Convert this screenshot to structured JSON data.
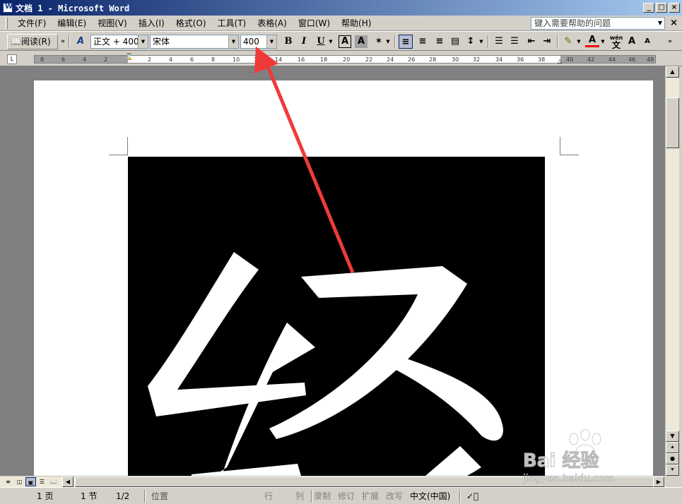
{
  "window": {
    "title": "文档 1 - Microsoft Word"
  },
  "menu": {
    "items": [
      "文件(F)",
      "编辑(E)",
      "视图(V)",
      "插入(I)",
      "格式(O)",
      "工具(T)",
      "表格(A)",
      "窗口(W)",
      "帮助(H)"
    ],
    "help_placeholder": "键入需要帮助的问题",
    "close_label": "×"
  },
  "toolbar": {
    "read_label": "阅读(R)",
    "style_value": "正文 + 400",
    "font_value": "宋体",
    "size_value": "400",
    "bold": "B",
    "italic": "I",
    "underline": "U",
    "char_border": "A",
    "char_shade": "A",
    "grow_font": "A",
    "shrink_font": "A",
    "phonetic_label": "wén"
  },
  "ruler": {
    "left_labels": [
      "8",
      "6",
      "4",
      "2"
    ],
    "right_labels": [
      "2",
      "4",
      "6",
      "8",
      "10",
      "12",
      "14",
      "16",
      "18",
      "20",
      "22",
      "24",
      "26",
      "28",
      "30",
      "32",
      "34",
      "36",
      "38",
      "40",
      "42",
      "44",
      "46",
      "48"
    ]
  },
  "document": {
    "character": "经"
  },
  "status": {
    "page": "1 页",
    "section": "1 节",
    "pages": "1/2",
    "position": "位置",
    "line": "行",
    "column": "列",
    "rec": "录制",
    "trk": "修订",
    "ext": "扩展",
    "ovr": "改写",
    "lang": "中文(中国)"
  },
  "watermark": {
    "brand": "Bai 经验",
    "url": "jingyan.baidu.com"
  },
  "colors": {
    "titlebar": "#0a246a",
    "arrow": "#f03a3a",
    "font_color_bar": "#ff0000"
  }
}
